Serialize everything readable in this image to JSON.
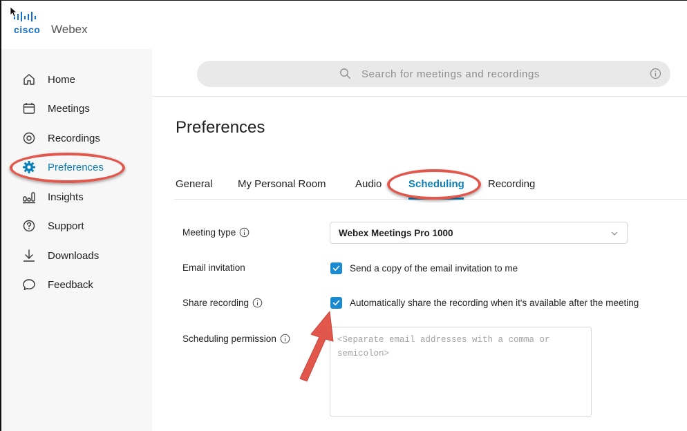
{
  "brand": {
    "cisco": "cisco",
    "product": "Webex"
  },
  "sidebar": {
    "items": [
      {
        "label": "Home",
        "icon": "home-icon"
      },
      {
        "label": "Meetings",
        "icon": "calendar-icon"
      },
      {
        "label": "Recordings",
        "icon": "record-icon"
      },
      {
        "label": "Preferences",
        "icon": "gear-icon",
        "active": true
      },
      {
        "label": "Insights",
        "icon": "insights-icon"
      },
      {
        "label": "Support",
        "icon": "help-icon"
      },
      {
        "label": "Downloads",
        "icon": "download-icon"
      },
      {
        "label": "Feedback",
        "icon": "feedback-icon"
      }
    ]
  },
  "search": {
    "placeholder": "Search for meetings and recordings"
  },
  "page": {
    "title": "Preferences"
  },
  "tabs": [
    {
      "label": "General"
    },
    {
      "label": "My Personal Room"
    },
    {
      "label": "Audio"
    },
    {
      "label": "Scheduling",
      "active": true
    },
    {
      "label": "Recording"
    }
  ],
  "form": {
    "meeting_type": {
      "label": "Meeting type",
      "value": "Webex Meetings Pro 1000"
    },
    "email_invitation": {
      "label": "Email invitation",
      "checkbox_label": "Send a copy of the email invitation to me",
      "checked": true
    },
    "share_recording": {
      "label": "Share recording",
      "checkbox_label": "Automatically share the recording when it's available after the meeting",
      "checked": true
    },
    "scheduling_permission": {
      "label": "Scheduling permission",
      "placeholder": "<Separate email addresses with a comma or semicolon>"
    }
  },
  "colors": {
    "accent": "#0b7fb8",
    "checkbox": "#1a8ad0",
    "annotation": "#e2574c",
    "sidebar_bg": "#f7f7f7"
  }
}
